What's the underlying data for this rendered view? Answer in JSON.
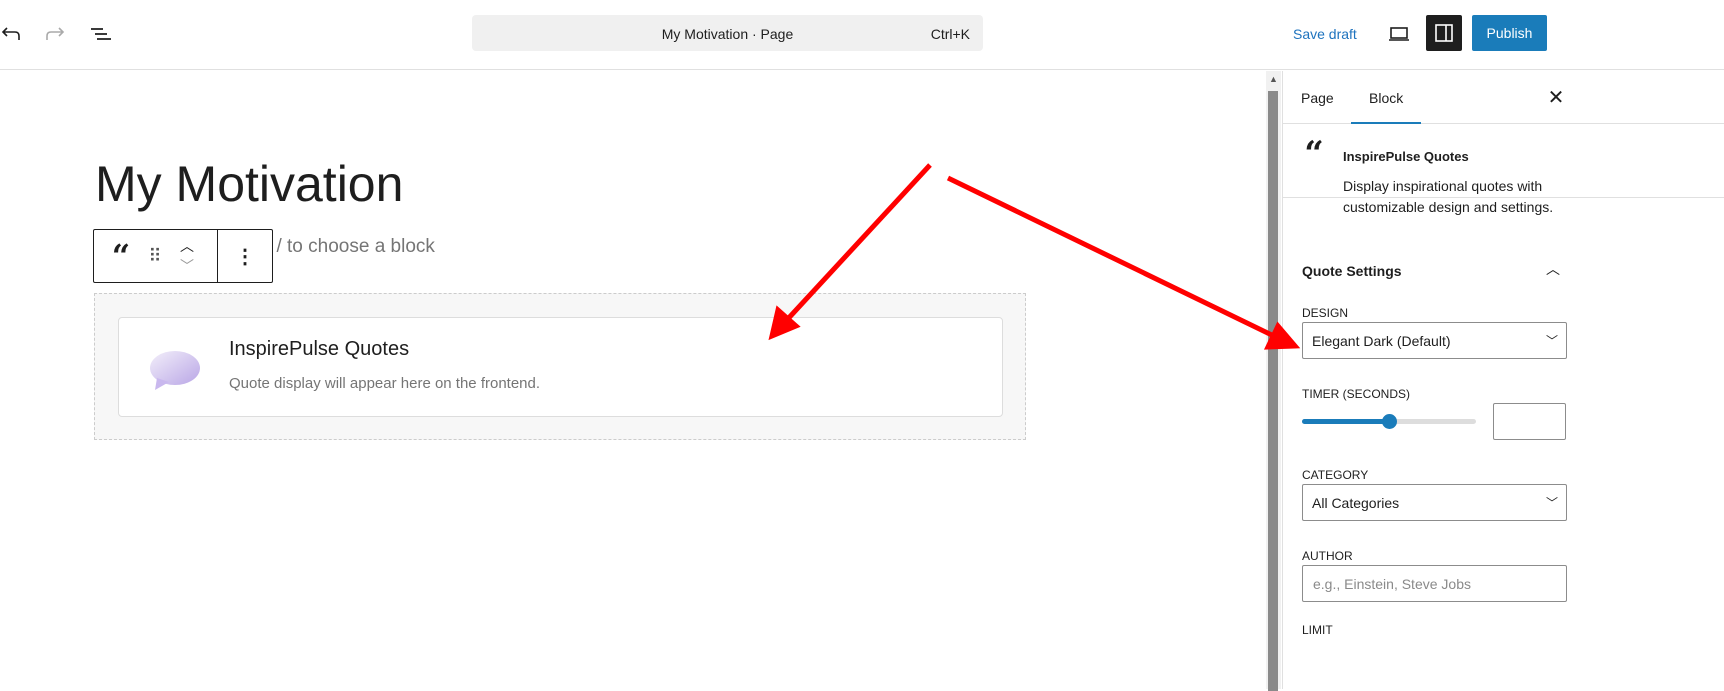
{
  "header": {
    "command_title": "My Motivation · Page",
    "shortcut": "Ctrl+K",
    "save_draft": "Save draft",
    "publish": "Publish"
  },
  "editor": {
    "page_title": "My Motivation",
    "block_placeholder": "Type / to choose a block",
    "block": {
      "title": "InspirePulse Quotes",
      "description": "Quote display will appear here on the frontend."
    }
  },
  "sidebar": {
    "tabs": [
      "Page",
      "Block"
    ],
    "active_tab": "Block",
    "block_name": "InspirePulse Quotes",
    "block_description": "Display inspirational quotes with customizable design and settings.",
    "section": "Quote Settings",
    "design_label": "DESIGN",
    "design_value": "Elegant Dark (Default)",
    "timer_label": "TIMER (SECONDS)",
    "timer_fraction": 0.5,
    "category_label": "CATEGORY",
    "category_value": "All Categories",
    "author_label": "AUTHOR",
    "author_placeholder": "e.g., Einstein, Steve Jobs",
    "limit_label": "LIMIT"
  },
  "colors": {
    "accent": "#1a7cba",
    "annotation": "#ff0000"
  }
}
